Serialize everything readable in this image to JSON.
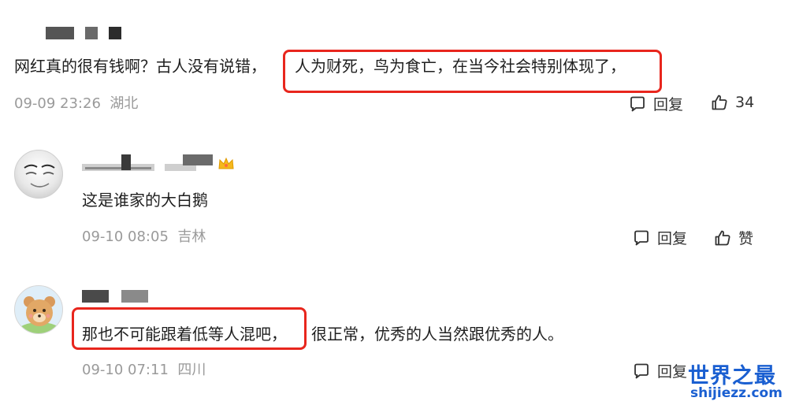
{
  "comments": [
    {
      "text_before": "网红真的很有钱啊？古人没有说错，",
      "text_highlight": "人为财死，鸟为食亡，在当今社会特别体现了，",
      "text_after": "",
      "date": "09-09 23:26",
      "location": "湖北",
      "reply_label": "回复",
      "like_label": "34"
    },
    {
      "text_before": "这是谁家的大白鹅",
      "text_highlight": "",
      "text_after": "",
      "date": "09-10 08:05",
      "location": "吉林",
      "reply_label": "回复",
      "like_label": "赞"
    },
    {
      "text_before": "",
      "text_highlight": "那也不可能跟着低等人混吧，",
      "text_after": "很正常，优秀的人当然跟优秀的人。",
      "date": "09-10 07:11",
      "location": "四川",
      "reply_label": "回复"
    }
  ],
  "watermark": {
    "title": "世界之最",
    "url": "shijiezz.com"
  },
  "colors": {
    "highlight_border": "#e8261d",
    "meta_text": "#9a9a9a",
    "watermark": "#1a5fd1"
  },
  "icons": [
    "comment-bubble-icon",
    "thumbs-up-icon",
    "crown-badge-icon"
  ]
}
